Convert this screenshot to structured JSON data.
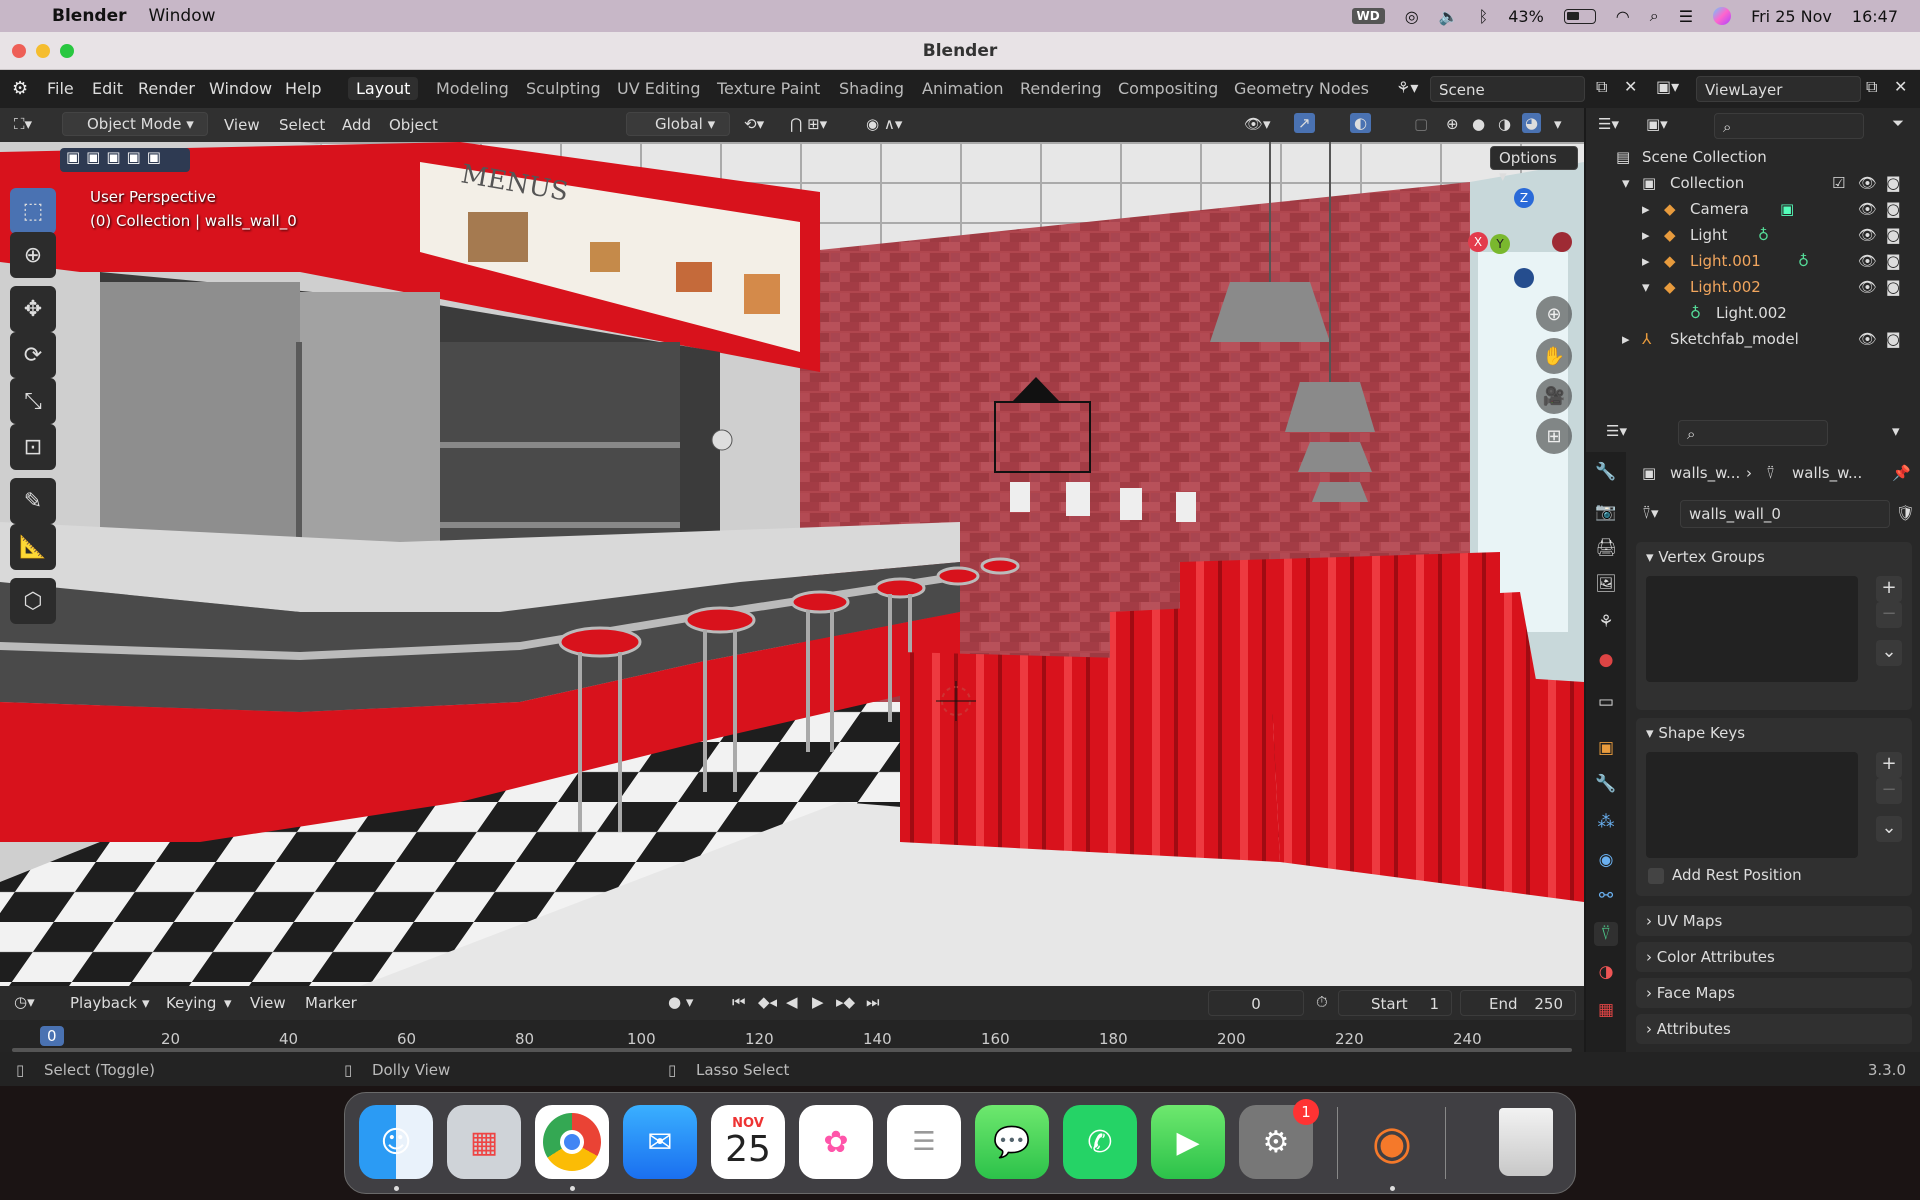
{
  "macmenu": {
    "apple": "",
    "app": "Blender",
    "items": [
      "Window"
    ],
    "battery": "43%",
    "date": "Fri 25 Nov",
    "time": "16:47",
    "icons": [
      "wd-icon",
      "creative-cloud-icon",
      "volume-icon",
      "bluetooth-icon",
      "battery-icon",
      "wifi-icon",
      "spotlight-icon",
      "control-center-icon",
      "siri-icon"
    ]
  },
  "window": {
    "title": "Blender"
  },
  "topbar": {
    "menus": [
      "File",
      "Edit",
      "Render",
      "Window",
      "Help"
    ],
    "workspaces": [
      "Layout",
      "Modeling",
      "Sculpting",
      "UV Editing",
      "Texture Paint",
      "Shading",
      "Animation",
      "Rendering",
      "Compositing",
      "Geometry Nodes"
    ],
    "active_workspace": "Layout",
    "scene": "Scene",
    "viewlayer": "ViewLayer"
  },
  "viewport_header": {
    "mode": "Object Mode",
    "menus": [
      "View",
      "Select",
      "Add",
      "Object"
    ],
    "orientation": "Global",
    "options": "Options"
  },
  "viewport": {
    "perspective": "User Perspective",
    "collection_info": "(0) Collection | walls_wall_0",
    "gizmo_axes": [
      "Z",
      "X",
      "Y"
    ],
    "menu_sign": "MENUS"
  },
  "outliner": {
    "root": "Scene Collection",
    "items": [
      {
        "label": "Collection",
        "depth": 1
      },
      {
        "label": "Camera",
        "depth": 2
      },
      {
        "label": "Light",
        "depth": 2
      },
      {
        "label": "Light.001",
        "depth": 2
      },
      {
        "label": "Light.002",
        "depth": 2
      },
      {
        "label": "Light.002",
        "depth": 3
      },
      {
        "label": "Sketchfab_model",
        "depth": 1
      }
    ]
  },
  "properties": {
    "breadcrumb_object": "walls_w...",
    "breadcrumb_mesh": "walls_w...",
    "mesh_name": "walls_wall_0",
    "panels": {
      "vertex_groups": "Vertex Groups",
      "shape_keys": "Shape Keys",
      "add_rest_position": "Add Rest Position",
      "uv_maps": "UV Maps",
      "color_attributes": "Color Attributes",
      "face_maps": "Face Maps",
      "attributes": "Attributes"
    }
  },
  "timeline": {
    "menus": [
      "Playback",
      "Keying",
      "View",
      "Marker"
    ],
    "current_frame": "0",
    "start_label": "Start",
    "start": "1",
    "end_label": "End",
    "end": "250",
    "ticks": [
      "0",
      "20",
      "40",
      "60",
      "80",
      "100",
      "120",
      "140",
      "160",
      "180",
      "200",
      "220",
      "240"
    ]
  },
  "statusbar": {
    "select": "Select (Toggle)",
    "dolly": "Dolly View",
    "lasso": "Lasso Select",
    "version": "3.3.0"
  },
  "dock": {
    "calendar_month": "NOV",
    "calendar_day": "25",
    "settings_badge": "1",
    "apps": [
      "Finder",
      "Launchpad",
      "Chrome",
      "Mail",
      "Calendar",
      "Photos",
      "Reminders",
      "Messages",
      "WhatsApp",
      "FaceTime",
      "System Preferences",
      "Blender",
      "Trash"
    ]
  },
  "colors": {
    "accent": "#4a72b2",
    "diner_red": "#d8121c",
    "brick": "#a8424a"
  }
}
